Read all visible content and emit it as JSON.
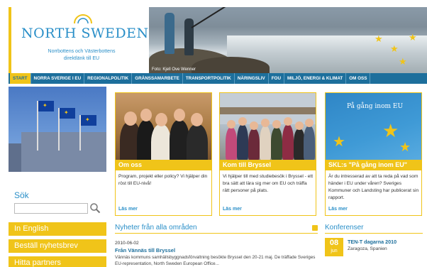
{
  "header": {
    "logo_title": "NORTH SWEDEN",
    "logo_subtitle_line1": "Norrbottens och Västerbottens",
    "logo_subtitle_line2": "direktlänk till EU",
    "hero_caption": "Foto: Kjell Ove Wenner"
  },
  "nav": {
    "items": [
      "START",
      "NORRA SVERIGE I EU",
      "REGIONALPOLITIK",
      "GRÄNSSAMARBETE",
      "TRANSPORTPOLITIK",
      "NÄRINGSLIV",
      "FOU",
      "MILJÖ, ENERGI & KLIMAT",
      "OM OSS"
    ],
    "active_index": 0
  },
  "sidebar": {
    "search_label": "Sök",
    "search_value": "",
    "buttons": [
      "In English",
      "Beställ nyhetsbrev",
      "Hitta partners"
    ]
  },
  "cards": [
    {
      "title": "Om oss",
      "text": "Program, projekt eller policy? Vi hjälper din röst till EU-nivå!",
      "more": "Läs mer"
    },
    {
      "title": "Kom till Bryssel",
      "text": "Vi hjälper till med studiebesök i Bryssel - ett bra sätt att lära sig mer om EU och träffa rätt personer på plats.",
      "more": "Läs mer"
    },
    {
      "title": "SKL:s \"På gång inom EU\"",
      "image_text": "På gång inom EU",
      "text": "Är du intresserad av att ta reda på vad som händer i EU under våren? Sveriges Kommuner och Landsting har publicerat sin rapport.",
      "more": "Läs mer"
    }
  ],
  "news": {
    "heading": "Nyheter från alla områden",
    "date": "2010-06-02",
    "item_title": "Från Vännäs till Bryssel",
    "item_text": "Vännäs kommuns samhällsbyggnadsförvaltning besökte Bryssel den 20-21 maj. De träffade Sveriges EU-representation, North Sweden European Office..."
  },
  "conferences": {
    "heading": "Konferenser",
    "day": "08",
    "month": "jun",
    "event": "TEN-T dagarna 2010",
    "place": "Zaragoza, Spanien"
  },
  "colors": {
    "accent_yellow": "#f0c419",
    "nav_blue": "#1d6f9c",
    "text_blue": "#2a8fc8"
  }
}
